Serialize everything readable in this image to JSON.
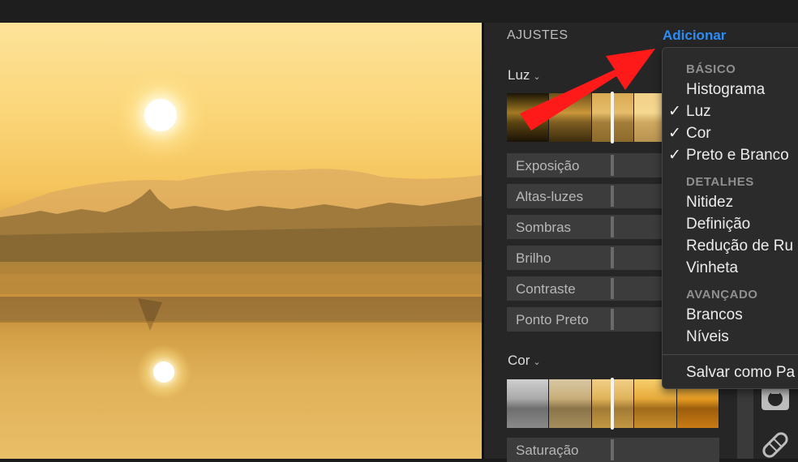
{
  "panel": {
    "title": "AJUSTES",
    "add_label": "Adicionar"
  },
  "sections": {
    "luz": {
      "title": "Luz",
      "sliders": [
        "Exposição",
        "Altas-luzes",
        "Sombras",
        "Brilho",
        "Contraste",
        "Ponto Preto"
      ]
    },
    "cor": {
      "title": "Cor",
      "sliders": [
        "Saturação"
      ]
    }
  },
  "menu": {
    "basic_header": "BÁSICO",
    "histograma": "Histograma",
    "luz": "Luz",
    "cor": "Cor",
    "preto_branco": "Preto e Branco",
    "detail_header": "DETALHES",
    "nitidez": "Nitidez",
    "definicao": "Definição",
    "reducao": "Redução de Ru",
    "vinheta": "Vinheta",
    "advanced_header": "AVANÇADO",
    "brancos": "Brancos",
    "niveis": "Níveis",
    "salvar": "Salvar como Pa",
    "checkmark": "✓"
  },
  "colors": {
    "accent": "#2d8cf5",
    "annotation_arrow": "#ff1a1a"
  },
  "icons": [
    "chevron-down-icon",
    "retouch-icon",
    "bandage-icon",
    "checkmark-icon"
  ]
}
